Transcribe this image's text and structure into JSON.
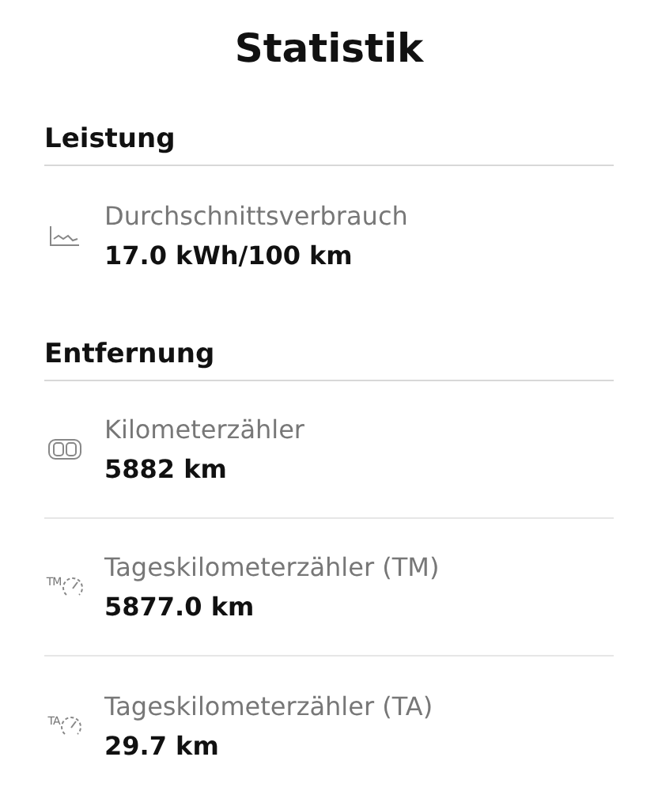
{
  "title": "Statistik",
  "sections": [
    {
      "heading": "Leistung",
      "items": [
        {
          "kind": "chart",
          "label": "Durchschnittsverbrauch",
          "value": "17.0 kWh/100 km"
        }
      ]
    },
    {
      "heading": "Entfernung",
      "items": [
        {
          "kind": "odometer",
          "label": "Kilometerzähler",
          "value": "5882 km"
        },
        {
          "kind": "trip",
          "badge": "TM",
          "label": "Tageskilometerzähler (TM)",
          "value": "5877.0 km"
        },
        {
          "kind": "trip",
          "badge": "TA",
          "label": "Tageskilometerzähler (TA)",
          "value": "29.7 km"
        }
      ]
    }
  ]
}
